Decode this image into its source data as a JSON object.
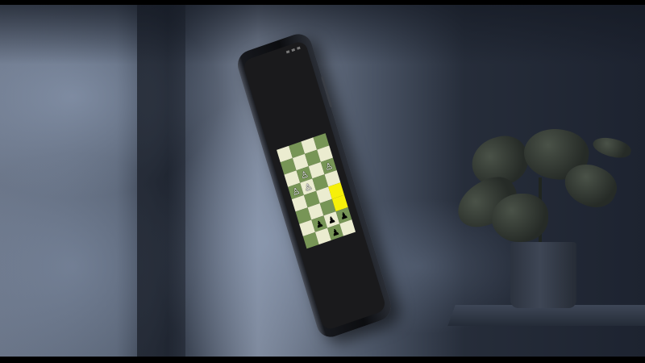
{
  "scene": {
    "description_icons": [
      "smartphone-icon",
      "potted-plant-icon"
    ],
    "colors": {
      "wall": "#5b6678",
      "phone_body": "#0c0d10",
      "board_light": "#ebecd0",
      "board_dark": "#779556",
      "highlight": "#f6f00a"
    }
  },
  "board": {
    "rows": [
      [
        "",
        "",
        "",
        ""
      ],
      [
        "",
        "",
        "",
        ""
      ],
      [
        "",
        "♙",
        "",
        "♙"
      ],
      [
        "♙",
        "♙",
        "",
        ""
      ],
      [
        "",
        "",
        "",
        ""
      ],
      [
        "",
        "",
        "",
        ""
      ],
      [
        "",
        "♟",
        "♟",
        "♟"
      ],
      [
        "",
        "",
        "♟",
        ""
      ]
    ],
    "highlighted": [
      [
        4,
        3
      ],
      [
        5,
        3
      ]
    ]
  }
}
